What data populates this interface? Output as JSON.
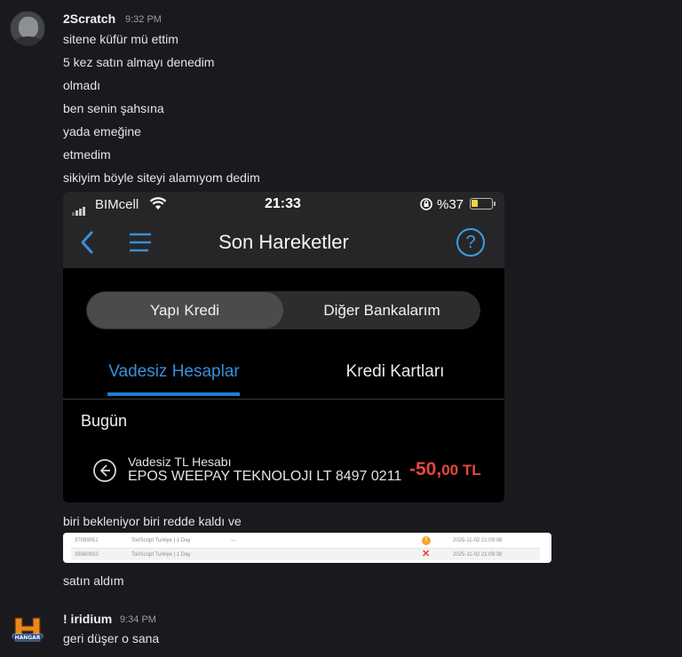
{
  "messages": [
    {
      "username": "2Scratch",
      "time": "9:32 PM",
      "lines": [
        "sitene küfür mü ettim",
        "5 kez satın almayı denedim",
        "olmadı",
        "ben senin şahsına",
        "yada emeğine",
        "etmedim",
        "sikiyim böyle siteyi alamıyom dedim"
      ],
      "after_image": "biri bekleniyor biri redde kaldı ve",
      "after_table": "satın aldım"
    },
    {
      "username": "! iridium",
      "time": "9:34 PM",
      "lines": [
        "geri düşer o sana"
      ],
      "avatar_text": "HANGAR"
    }
  ],
  "phone": {
    "status": {
      "carrier": "BIMcell",
      "time": "21:33",
      "battery": "%37",
      "battery_level": 0.37
    },
    "nav": {
      "title": "Son Hareketler",
      "help": "?"
    },
    "segment": {
      "left": "Yapı Kredi",
      "right": "Diğer Bankalarım",
      "active": "left"
    },
    "tabs": {
      "active": "Vadesiz Hesaplar",
      "inactive": "Kredi Kartları"
    },
    "day": "Bugün",
    "transaction": {
      "account": "Vadesiz TL Hesabı",
      "description": "EPOS WEEPAY TEKNOLOJI LT 8497 0211",
      "amount_main": "-50,",
      "amount_dec": "00 TL"
    },
    "colors": {
      "accent": "#1d7fd6",
      "negative": "#e5483f"
    }
  },
  "table": {
    "rows": [
      {
        "id": "37089051",
        "product": "ToirScript Turkiye | 1 Day",
        "extra": "---",
        "status": "pending",
        "date": "2025-11-02 21:09:08"
      },
      {
        "id": "39360910",
        "product": "ToirScript Turkiye | 1 Day",
        "extra": "",
        "status": "failed",
        "date": "2025-11-02 21:09:39"
      }
    ]
  },
  "colors": {
    "background": "#1a1a1e",
    "pending": "#f3a42a",
    "failed": "#e53a34"
  }
}
